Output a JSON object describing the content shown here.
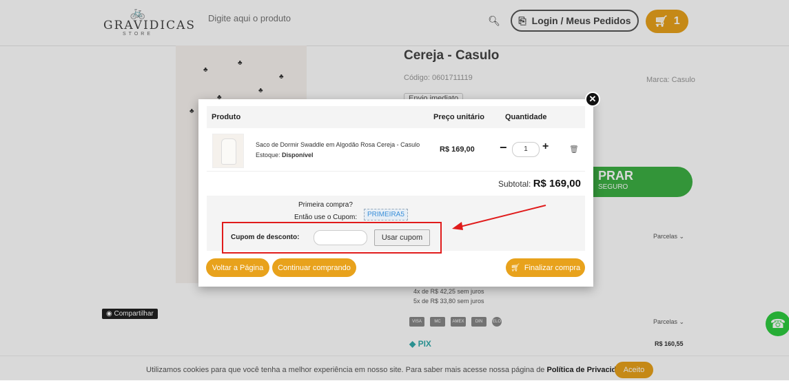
{
  "header": {
    "logo_name": "GRAVIDICAS",
    "logo_sub": "STORE",
    "search_placeholder": "Digite aqui o produto",
    "login_label": "Login / Meus Pedidos",
    "cart_count": "1"
  },
  "product_page": {
    "title": "Cereja - Casulo",
    "code": "Código: 0601711119",
    "brand": "Marca: Casulo",
    "badge": "Envio imediato",
    "buy_label": "PRAR",
    "buy_sub": "SEGURO",
    "installments_label": "Parcelas",
    "installment_line1": "4x de R$ 42,25 sem juros",
    "installment_line2": "5x de R$ 33,80 sem juros",
    "share_label": "Compartilhar",
    "pix_label": "PIX",
    "pix_price": "R$ 160,55",
    "cards": [
      "VISA",
      "MC",
      "AMEX",
      "DIN",
      "ELO"
    ]
  },
  "cookie": {
    "text": "Utilizamos cookies para que você tenha a melhor experiência em nosso site. Para saber mais acesse nossa página de",
    "link": "Política de Privacidade",
    "button": "Aceito"
  },
  "modal": {
    "headers": {
      "product": "Produto",
      "unit_price": "Preço unitário",
      "quantity": "Quantidade"
    },
    "item": {
      "name": "Saco de Dormir Swaddle em Algodão Rosa Cereja - Casulo",
      "stock_label": "Estoque:",
      "stock_value": "Disponível",
      "price": "R$ 169,00",
      "qty": "1"
    },
    "subtotal_label": "Subtotal:",
    "subtotal_value": "R$ 169,00",
    "first_purchase": "Primeira compra?",
    "use_coupon": "Então use o Cupom:",
    "coupon_code": "PRIMEIRA5",
    "coupon_label": "Cupom de desconto:",
    "coupon_value": "",
    "coupon_button": "Usar cupom",
    "back_button": "Voltar a Página",
    "continue_button": "Continuar comprando",
    "checkout_button": "Finalizar compra"
  },
  "colors": {
    "accent": "#e8a21c",
    "buy": "#3cb043",
    "highlight": "#e01b1b"
  }
}
